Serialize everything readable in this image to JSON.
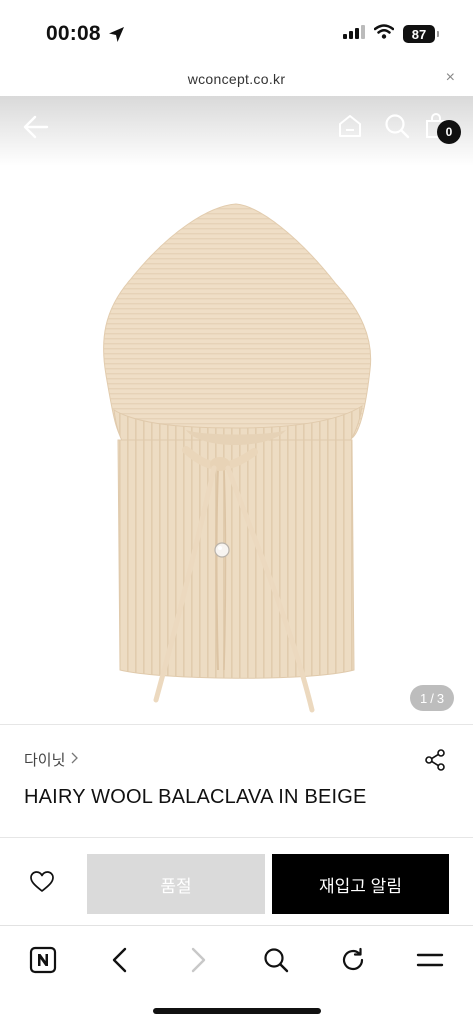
{
  "status": {
    "time": "00:08",
    "battery": "87"
  },
  "url_bar": {
    "domain": "wconcept.co.kr",
    "close": "×"
  },
  "header": {
    "cart_count": "0"
  },
  "gallery": {
    "current": "1",
    "separator": "/",
    "total": "3"
  },
  "product": {
    "brand": "다이닛",
    "brand_chevron": ">",
    "name": "HAIRY WOOL BALACLAVA IN BEIGE"
  },
  "actions": {
    "soldout_label": "품절",
    "restock_label": "재입고 알림"
  },
  "colors": {
    "knit": "#f0dfc8",
    "soldout_bg": "#dadada",
    "primary": "#000000"
  },
  "icons": {
    "header": [
      "back-arrow-icon",
      "home-icon",
      "search-icon",
      "shopping-bag-icon"
    ],
    "toolbar": [
      "naver-logo-icon",
      "back-icon",
      "forward-icon",
      "search-icon",
      "refresh-icon",
      "menu-icon"
    ]
  }
}
